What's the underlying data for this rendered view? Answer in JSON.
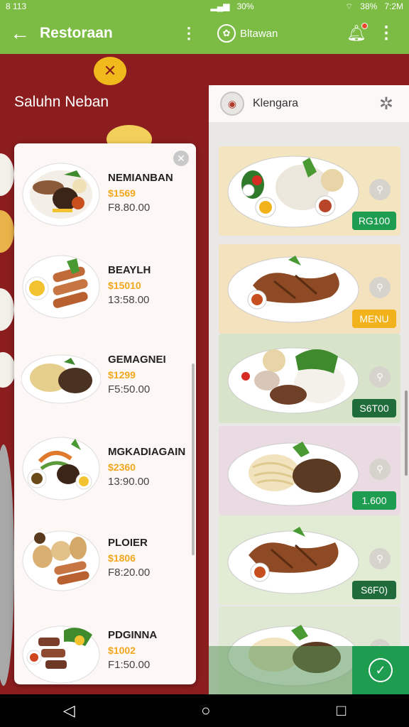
{
  "status_bar": {
    "time_left": "8 113",
    "battery_left": "30%",
    "battery_right": "38%",
    "time_right": "7:2M"
  },
  "app_bar": {
    "title": "Restoraan",
    "brand_name": "Bltawan"
  },
  "background": {
    "title": "Saluhn Neban"
  },
  "menu_list": {
    "items": [
      {
        "name": "NEMIANBAN",
        "price": "$1569",
        "sub": "F8.80.00",
        "icon": "sausage-plate-icon"
      },
      {
        "name": "BEAYLH",
        "price": "$15010",
        "sub": "13:58.00",
        "icon": "grilled-plate-icon"
      },
      {
        "name": "GEMAGNEI",
        "price": "$1299",
        "sub": "F5:50.00",
        "icon": "rice-plate-icon"
      },
      {
        "name": "MGKADIAGAIN",
        "price": "$2360",
        "sub": "13:90.00",
        "icon": "veggie-plate-icon"
      },
      {
        "name": "PLOIER",
        "price": "$1806",
        "sub": "F8:20.00",
        "icon": "rolls-plate-icon"
      },
      {
        "name": "PDGINNA",
        "price": "$1002",
        "sub": "F1:50.00",
        "icon": "skewer-plate-icon"
      }
    ]
  },
  "right_panel": {
    "title": "Klengara",
    "cards": [
      {
        "tag": "RG100",
        "tag_color": "#1e9c50",
        "bg": "#f3e5bf"
      },
      {
        "tag": "MENU",
        "tag_color": "#f2b21b",
        "bg": "#f3e2bd"
      },
      {
        "tag": "S6T00",
        "tag_color": "#1f6b3a",
        "bg": "#d7e4c9"
      },
      {
        "tag": "1.600",
        "tag_color": "#1e9c50",
        "bg": "#eadbe3"
      },
      {
        "tag": "S6F0)",
        "tag_color": "#1f6b3a",
        "bg": "#e2ecd4"
      },
      {
        "tag": "",
        "tag_color": "#1e9c50",
        "bg": "#dfe8d3"
      }
    ]
  },
  "colors": {
    "accent": "#7cbc44",
    "brand_red": "#8c1d1f",
    "price": "#f2a81d"
  }
}
